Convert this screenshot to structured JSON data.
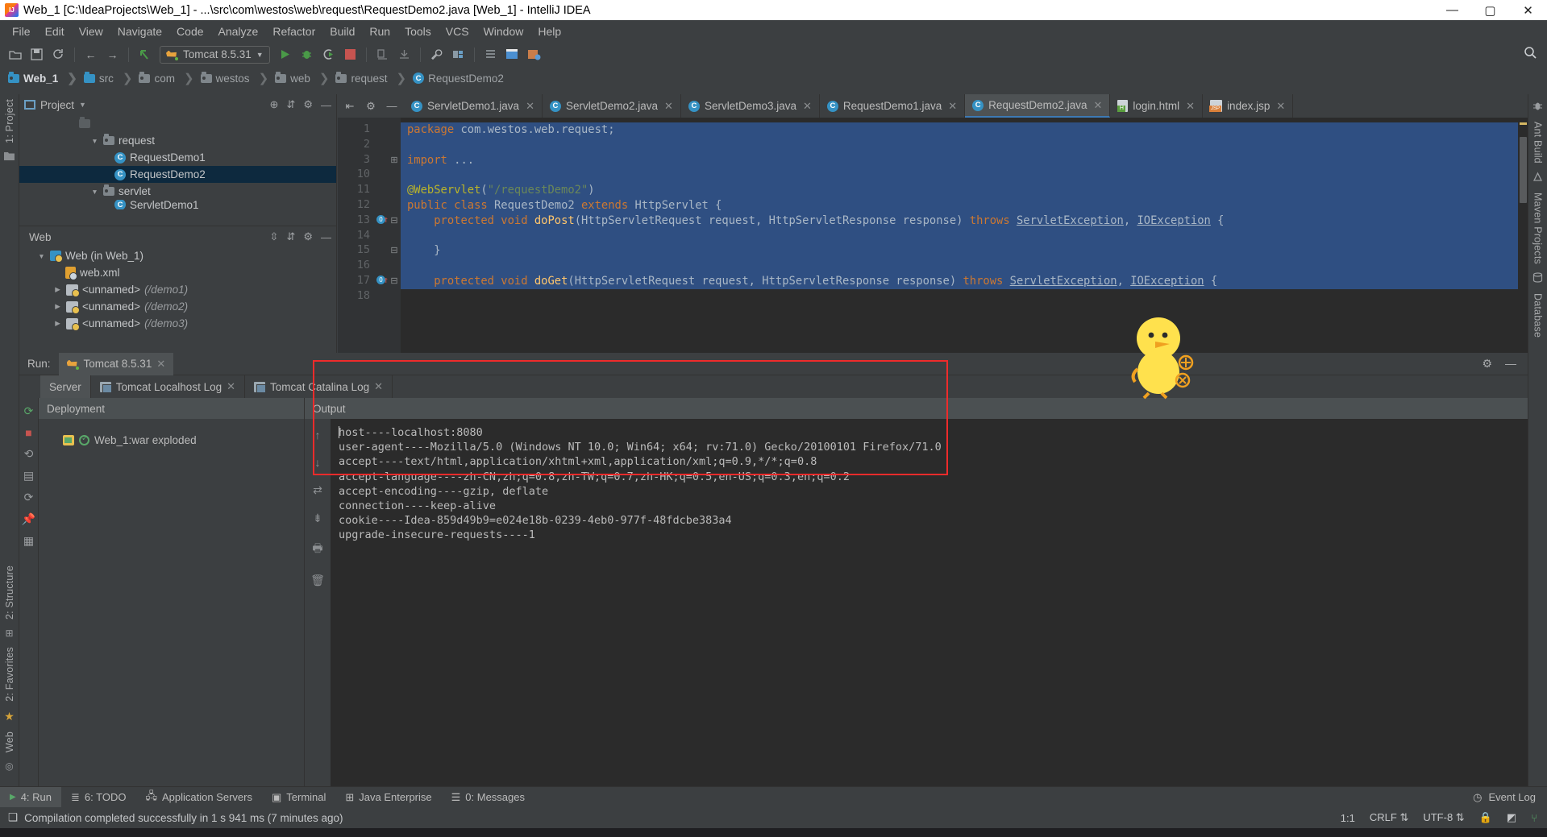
{
  "window": {
    "title": "Web_1 [C:\\IdeaProjects\\Web_1] - ...\\src\\com\\westos\\web\\request\\RequestDemo2.java [Web_1] - IntelliJ IDEA",
    "minimize": "—",
    "maximize": "▢",
    "close": "✕"
  },
  "menu": [
    "File",
    "Edit",
    "View",
    "Navigate",
    "Code",
    "Analyze",
    "Refactor",
    "Build",
    "Run",
    "Tools",
    "VCS",
    "Window",
    "Help"
  ],
  "toolbar": {
    "run_config": "Tomcat 8.5.31",
    "icons": [
      "open-folder-icon",
      "save-icon",
      "sync-icon",
      "back-arrow-icon",
      "forward-arrow-icon",
      "undo-icon",
      "run-icon",
      "debug-icon",
      "run-coverage-icon",
      "stop-icon",
      "build-icon",
      "download-icon",
      "wrench-icon",
      "structure-icon",
      "layout-icon",
      "browser-icon",
      "db-icon"
    ],
    "search": "search-icon"
  },
  "breadcrumb": [
    "Web_1",
    "src",
    "com",
    "westos",
    "web",
    "request",
    "RequestDemo2"
  ],
  "left_rail": [
    "1: Project",
    "2: Structure",
    "2: Favorites",
    "Web"
  ],
  "right_rail": [
    "Ant Build",
    "Maven Projects",
    "Database"
  ],
  "project_panel": {
    "title": "Project",
    "tree": [
      {
        "indent": 3,
        "arrow": "▼",
        "icon": "package-icon",
        "label": "request",
        "italic": false,
        "selected": false
      },
      {
        "indent": 4,
        "arrow": "",
        "icon": "class-icon",
        "label": "RequestDemo1",
        "italic": false,
        "selected": false
      },
      {
        "indent": 4,
        "arrow": "",
        "icon": "class-icon",
        "label": "RequestDemo2",
        "italic": false,
        "selected": true
      },
      {
        "indent": 3,
        "arrow": "▼",
        "icon": "package-icon",
        "label": "servlet",
        "italic": false,
        "selected": false
      },
      {
        "indent": 4,
        "arrow": "",
        "icon": "class-icon",
        "label": "ServletDemo1",
        "italic": false,
        "selected": false
      }
    ]
  },
  "web_panel": {
    "title": "Web",
    "tree": [
      {
        "indent": 0,
        "arrow": "▼",
        "icon": "web-module-icon",
        "label": "Web (in Web_1)",
        "italic": false
      },
      {
        "indent": 1,
        "arrow": "",
        "icon": "xml-icon",
        "label": "web.xml",
        "italic": false
      },
      {
        "indent": 1,
        "arrow": "▶",
        "icon": "servlet-icon",
        "label": "<unnamed>",
        "suffix": "(/demo1)",
        "italic": true
      },
      {
        "indent": 1,
        "arrow": "▶",
        "icon": "servlet-icon",
        "label": "<unnamed>",
        "suffix": "(/demo2)",
        "italic": true
      },
      {
        "indent": 1,
        "arrow": "▶",
        "icon": "servlet-icon",
        "label": "<unnamed>",
        "suffix": "(/demo3)",
        "italic": true
      }
    ]
  },
  "editor": {
    "tabs": [
      {
        "label": "ServletDemo1.java",
        "icon": "class-icon",
        "active": false
      },
      {
        "label": "ServletDemo2.java",
        "icon": "class-icon",
        "active": false
      },
      {
        "label": "ServletDemo3.java",
        "icon": "class-icon",
        "active": false
      },
      {
        "label": "RequestDemo1.java",
        "icon": "class-icon",
        "active": false
      },
      {
        "label": "RequestDemo2.java",
        "icon": "class-icon",
        "active": true
      },
      {
        "label": "login.html",
        "icon": "html-icon",
        "active": false
      },
      {
        "label": "index.jsp",
        "icon": "jsp-icon",
        "active": false
      }
    ],
    "close_glyph": "✕",
    "line_numbers": [
      "1",
      "2",
      "3",
      "10",
      "11",
      "12",
      "13",
      "14",
      "15",
      "16",
      "17",
      "18"
    ],
    "code_lines": [
      "package com.westos.web.request;",
      "",
      "import ...",
      "",
      "@WebServlet(\"/requestDemo2\")",
      "public class RequestDemo2 extends HttpServlet {",
      "    protected void doPost(HttpServletRequest request, HttpServletResponse response) throws ServletException, IOException {",
      "",
      "    }",
      "",
      "    protected void doGet(HttpServletRequest request, HttpServletResponse response) throws ServletException, IOException {",
      ""
    ]
  },
  "run_panel": {
    "label": "Run:",
    "tab": "Tomcat 8.5.31",
    "subtabs": [
      {
        "label": "Server",
        "active": true,
        "closable": false
      },
      {
        "label": "Tomcat Localhost Log",
        "active": false,
        "closable": true
      },
      {
        "label": "Tomcat Catalina Log",
        "active": false,
        "closable": true
      }
    ],
    "deployment_header": "Deployment",
    "deployment_item": "Web_1:war exploded",
    "output_header": "Output",
    "console_lines": [
      "host----localhost:8080",
      "user-agent----Mozilla/5.0 (Windows NT 10.0; Win64; x64; rv:71.0) Gecko/20100101 Firefox/71.0",
      "accept----text/html,application/xhtml+xml,application/xml;q=0.9,*/*;q=0.8",
      "accept-language----zh-CN,zh;q=0.8,zh-TW;q=0.7,zh-HK;q=0.5,en-US;q=0.3,en;q=0.2",
      "accept-encoding----gzip, deflate",
      "connection----keep-alive",
      "cookie----Idea-859d49b9=e024e18b-0239-4eb0-977f-48fdcbe383a4",
      "upgrade-insecure-requests----1"
    ],
    "highlight_color": "#ee2b2b"
  },
  "bottom_bar": [
    {
      "label": "4: Run",
      "icon": "run-icon",
      "active": true
    },
    {
      "label": "6: TODO",
      "icon": "todo-icon",
      "active": false
    },
    {
      "label": "Application Servers",
      "icon": "server-icon",
      "active": false
    },
    {
      "label": "Terminal",
      "icon": "terminal-icon",
      "active": false
    },
    {
      "label": "Java Enterprise",
      "icon": "jee-icon",
      "active": false
    },
    {
      "label": "0: Messages",
      "icon": "messages-icon",
      "active": false
    }
  ],
  "bottom_bar_right": "Event Log",
  "status_bar": {
    "message": "Compilation completed successfully in 1 s 941 ms (7 minutes ago)",
    "caret": "1:1",
    "line_sep": "CRLF",
    "encoding": "UTF-8"
  }
}
